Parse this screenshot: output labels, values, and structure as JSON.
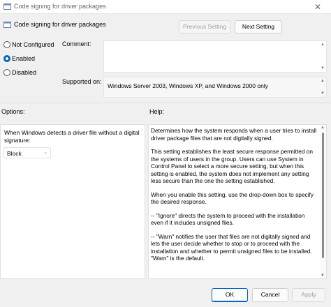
{
  "window": {
    "title": "Code signing for driver packages",
    "close_icon": "close-icon"
  },
  "header": {
    "setting_name": "Code signing for driver packages",
    "previous_label": "Previous Setting",
    "next_label": "Next Setting"
  },
  "state": {
    "options": [
      {
        "label": "Not Configured",
        "checked": false
      },
      {
        "label": "Enabled",
        "checked": true
      },
      {
        "label": "Disabled",
        "checked": false
      }
    ]
  },
  "fields": {
    "comment_label": "Comment:",
    "comment_value": "",
    "supported_label": "Supported on:",
    "supported_value": "Windows Server 2003, Windows XP, and Windows 2000 only"
  },
  "options_section": {
    "label": "Options:",
    "description": "When Windows detects a driver file without a digital signature:",
    "selected": "Block"
  },
  "help_section": {
    "label": "Help:",
    "paragraphs": [
      "Determines how the system responds when a user tries to install driver package files that are not digitally signed.",
      "This setting establishes the least secure response permitted on the systems of users in the group. Users can use System in Control Panel to select a more secure setting, but when this setting is enabled, the system does not implement any setting less secure than the one the setting established.",
      "When you enable this setting, use the drop-down box to specify the desired response.",
      "--   \"Ignore\" directs the system to proceed with the installation even if it includes unsigned files.",
      "--   \"Warn\" notifies the user that files are not digitally signed and lets the user decide whether to stop or to proceed with the installation and whether to permit unsigned files to be installed. \"Warn\" is the default."
    ]
  },
  "footer": {
    "ok_label": "OK",
    "cancel_label": "Cancel",
    "apply_label": "Apply"
  },
  "colors": {
    "accent": "#0067c0",
    "background": "#f0f0f0"
  }
}
